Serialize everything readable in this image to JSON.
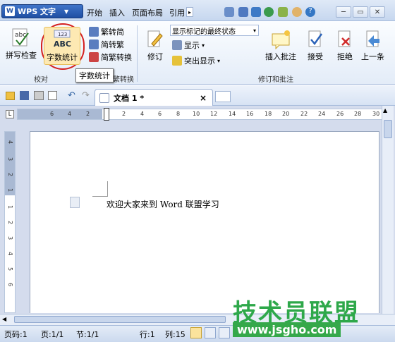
{
  "titlebar": {
    "app_button": "WPS 文字",
    "tabs": [
      "开始",
      "插入",
      "页面布局",
      "引用"
    ]
  },
  "ribbon": {
    "spellcheck": "拼写检查",
    "wordcount": "字数统计",
    "wordcount_tooltip": "字数统计",
    "jianzhuanfan": "繁转简",
    "fanzhuanjian": "简转繁",
    "jianfanzhuanhuan": "简繁转换",
    "revise": "修订",
    "markup_select": "显示标记的最终状态",
    "show": "显示",
    "highlight": "突出显示",
    "insert_comment": "插入批注",
    "accept": "接受",
    "reject": "拒绝",
    "prev": "上一条",
    "group_proofing": "校对",
    "group_chinese": "中文简繁转换",
    "group_revision": "修订和批注"
  },
  "doctab": {
    "title": "文档 1 *",
    "close": "×"
  },
  "ruler": {
    "ticks": [
      "6",
      "4",
      "2",
      "2",
      "4",
      "6",
      "8",
      "10",
      "12",
      "14",
      "16",
      "18",
      "20",
      "22",
      "24",
      "26",
      "28",
      "30"
    ],
    "vticks": [
      "4",
      "3",
      "2",
      "1",
      "1",
      "2",
      "3",
      "4",
      "5",
      "6"
    ]
  },
  "document": {
    "text": "欢迎大家来到 Word 联盟学习"
  },
  "statusbar": {
    "page_code": "页码:1",
    "page": "页:1/1",
    "section": "节:1/1",
    "row": "行:1",
    "col": "列:15"
  },
  "watermark": {
    "text": "技术员联盟",
    "url": "www.jsgho.com"
  }
}
